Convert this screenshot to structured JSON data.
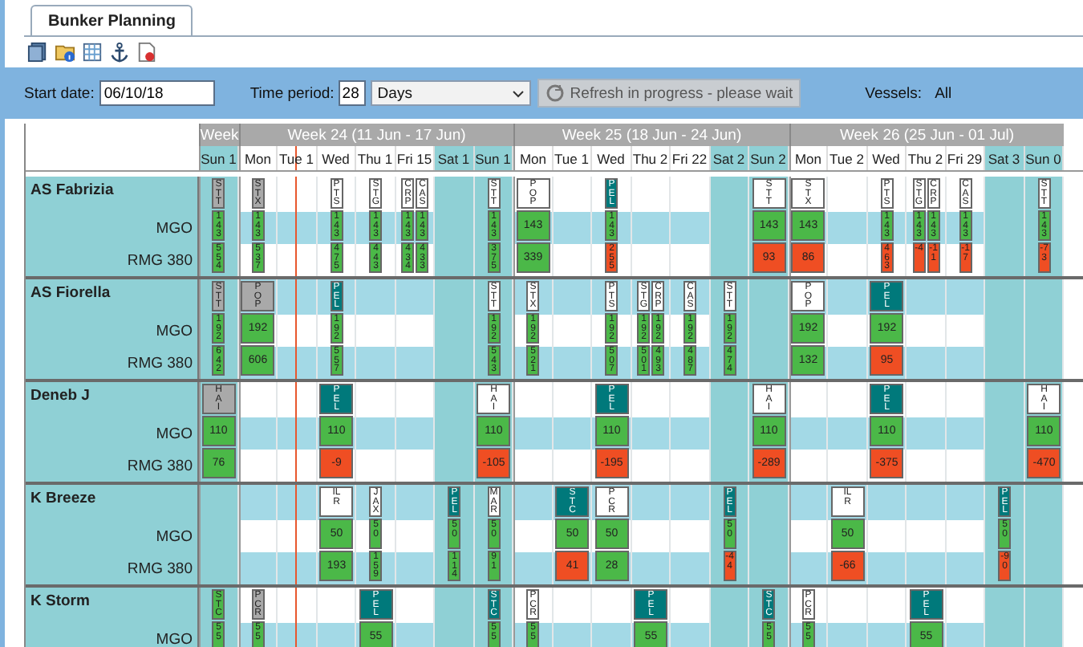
{
  "tab": {
    "label": "Bunker Planning",
    "selected": true
  },
  "filters": {
    "start_date_label": "Start date:",
    "start_date": "06/10/18",
    "period_label": "Time period:",
    "period": "28",
    "unit": "Days",
    "refresh_button": {
      "label": "Refresh in progress - please wait",
      "disabled": true
    },
    "vessels_label": "Vessels:",
    "vessels_value": "All"
  },
  "schedule": {
    "weeks": [
      {
        "label": "Week",
        "days": [
          {
            "label": "Sun 1",
            "weekend": true,
            "current": false
          }
        ]
      },
      {
        "label": "Week 24 (11 Jun - 17 Jun)",
        "days": [
          {
            "label": "Mon",
            "weekend": false,
            "current": false
          },
          {
            "label": "Tue 1",
            "weekend": false,
            "current": true
          },
          {
            "label": "Wed",
            "weekend": false,
            "current": false
          },
          {
            "label": "Thu 1",
            "weekend": false,
            "current": false
          },
          {
            "label": "Fri 15",
            "weekend": false,
            "current": false
          },
          {
            "label": "Sat 1",
            "weekend": true,
            "current": false
          },
          {
            "label": "Sun 1",
            "weekend": true,
            "current": false
          }
        ]
      },
      {
        "label": "Week 25 (18 Jun - 24 Jun)",
        "days": [
          {
            "label": "Mon",
            "weekend": false,
            "current": false
          },
          {
            "label": "Tue 1",
            "weekend": false,
            "current": false
          },
          {
            "label": "Wed",
            "weekend": false,
            "current": false
          },
          {
            "label": "Thu 2",
            "weekend": false,
            "current": false
          },
          {
            "label": "Fri 22",
            "weekend": false,
            "current": false
          },
          {
            "label": "Sat 2",
            "weekend": true,
            "current": false
          },
          {
            "label": "Sun 2",
            "weekend": true,
            "current": false
          }
        ]
      },
      {
        "label": "Week 26 (25 Jun - 01 Jul)",
        "days": [
          {
            "label": "Mon",
            "weekend": false,
            "current": false
          },
          {
            "label": "Tue 2",
            "weekend": false,
            "current": false
          },
          {
            "label": "Wed",
            "weekend": false,
            "current": false
          },
          {
            "label": "Thu 2",
            "weekend": false,
            "current": false
          },
          {
            "label": "Fri 29",
            "weekend": false,
            "current": false
          },
          {
            "label": "Sat 3",
            "weekend": true,
            "current": false
          },
          {
            "label": "Sun 0",
            "weekend": true,
            "current": false
          }
        ]
      }
    ],
    "vessels": [
      {
        "name": "AS Fabrizia",
        "fuels": [
          "MGO",
          "RMG 380"
        ],
        "calls": [
          {
            "port": "STT",
            "kind": "grey",
            "wide": false,
            "amounts": [
              {
                "value": "143",
                "short": false
              },
              {
                "value": "554",
                "short": false
              }
            ]
          },
          {
            "port": "STX",
            "kind": "grey",
            "wide": false,
            "amounts": [
              {
                "value": "143",
                "short": false
              },
              {
                "value": "537",
                "short": false
              }
            ]
          },
          {
            "port": "PTS",
            "kind": "white",
            "wide": false,
            "amounts": [
              {
                "value": "143",
                "short": false
              },
              {
                "value": "475",
                "short": false
              }
            ]
          },
          {
            "port": "STG",
            "kind": "white",
            "wide": false,
            "amounts": [
              {
                "value": "143",
                "short": false
              },
              {
                "value": "443",
                "short": false
              }
            ]
          },
          {
            "port": "CRP",
            "kind": "white",
            "wide": false,
            "amounts": [
              {
                "value": "143",
                "short": false
              },
              {
                "value": "434",
                "short": false
              }
            ]
          },
          {
            "port": "CAS",
            "kind": "white",
            "wide": false,
            "amounts": [
              {
                "value": "143",
                "short": false
              },
              {
                "value": "433",
                "short": false
              }
            ]
          },
          {
            "port": "STT",
            "kind": "white",
            "wide": false,
            "amounts": [
              {
                "value": "143",
                "short": false
              },
              {
                "value": "375",
                "short": false
              }
            ]
          },
          {
            "port": "POP",
            "kind": "white",
            "wide": true,
            "amounts": [
              {
                "value": "143",
                "short": false
              },
              {
                "value": "339",
                "short": false
              }
            ]
          },
          {
            "port": "PEL",
            "kind": "teal",
            "wide": false,
            "amounts": [
              {
                "value": "143",
                "short": false
              },
              {
                "value": "255",
                "short": true
              }
            ]
          },
          {
            "port": "STT",
            "kind": "white",
            "wide": true,
            "amounts": [
              {
                "value": "143",
                "short": false
              },
              {
                "value": "93",
                "short": true
              }
            ]
          },
          {
            "port": "STX",
            "kind": "white",
            "wide": true,
            "amounts": [
              {
                "value": "143",
                "short": false
              },
              {
                "value": "86",
                "short": true
              }
            ]
          },
          {
            "port": "PTS",
            "kind": "white",
            "wide": false,
            "amounts": [
              {
                "value": "143",
                "short": false
              },
              {
                "value": "463",
                "short": true
              }
            ]
          },
          {
            "port": "STG",
            "kind": "white",
            "wide": false,
            "amounts": [
              {
                "value": "143",
                "short": false
              },
              {
                "value": "-4",
                "short": true
              }
            ]
          },
          {
            "port": "CRP",
            "kind": "white",
            "wide": false,
            "amounts": [
              {
                "value": "143",
                "short": false
              },
              {
                "value": "-11",
                "short": true
              }
            ]
          },
          {
            "port": "CAS",
            "kind": "white",
            "wide": false,
            "amounts": [
              {
                "value": "143",
                "short": false
              },
              {
                "value": "-17",
                "short": true
              }
            ]
          },
          {
            "port": "STT",
            "kind": "white",
            "wide": false,
            "amounts": [
              {
                "value": "143",
                "short": false
              },
              {
                "value": "-73",
                "short": true
              }
            ]
          }
        ]
      },
      {
        "name": "AS Fiorella",
        "fuels": [
          "MGO",
          "RMG 380"
        ],
        "calls": [
          {
            "port": "STT",
            "kind": "grey",
            "wide": false,
            "amounts": [
              {
                "value": "192",
                "short": false
              },
              {
                "value": "642",
                "short": false
              }
            ]
          },
          {
            "port": "POP",
            "kind": "grey",
            "wide": true,
            "amounts": [
              {
                "value": "192",
                "short": false
              },
              {
                "value": "606",
                "short": false
              }
            ]
          },
          {
            "port": "PEL",
            "kind": "teal",
            "wide": false,
            "amounts": [
              {
                "value": "192",
                "short": false
              },
              {
                "value": "557",
                "short": false
              }
            ]
          },
          {
            "port": "STT",
            "kind": "white",
            "wide": false,
            "amounts": [
              {
                "value": "192",
                "short": false
              },
              {
                "value": "543",
                "short": false
              }
            ]
          },
          {
            "port": "STX",
            "kind": "white",
            "wide": false,
            "amounts": [
              {
                "value": "192",
                "short": false
              },
              {
                "value": "521",
                "short": false
              }
            ]
          },
          {
            "port": "PTS",
            "kind": "white",
            "wide": false,
            "amounts": [
              {
                "value": "192",
                "short": false
              },
              {
                "value": "507",
                "short": false
              }
            ]
          },
          {
            "port": "STG",
            "kind": "white",
            "wide": false,
            "amounts": [
              {
                "value": "192",
                "short": false
              },
              {
                "value": "501",
                "short": false
              }
            ]
          },
          {
            "port": "CRP",
            "kind": "white",
            "wide": false,
            "amounts": [
              {
                "value": "192",
                "short": false
              },
              {
                "value": "493",
                "short": false
              }
            ]
          },
          {
            "port": "CAS",
            "kind": "white",
            "wide": false,
            "amounts": [
              {
                "value": "192",
                "short": false
              },
              {
                "value": "487",
                "short": false
              }
            ]
          },
          {
            "port": "STT",
            "kind": "white",
            "wide": false,
            "amounts": [
              {
                "value": "192",
                "short": false
              },
              {
                "value": "474",
                "short": false
              }
            ]
          },
          {
            "port": "POP",
            "kind": "white",
            "wide": true,
            "amounts": [
              {
                "value": "192",
                "short": false
              },
              {
                "value": "132",
                "short": false
              }
            ]
          },
          {
            "port": "PEL",
            "kind": "teal",
            "wide": true,
            "amounts": [
              {
                "value": "192",
                "short": false
              },
              {
                "value": "95",
                "short": true
              }
            ]
          }
        ]
      },
      {
        "name": "Deneb J",
        "fuels": [
          "MGO",
          "RMG 380"
        ],
        "calls": [
          {
            "port": "HAI",
            "kind": "grey",
            "wide": true,
            "amounts": [
              {
                "value": "110",
                "short": false
              },
              {
                "value": "76",
                "short": false
              }
            ]
          },
          {
            "port": "PEL",
            "kind": "teal",
            "wide": true,
            "amounts": [
              {
                "value": "110",
                "short": false
              },
              {
                "value": "-9",
                "short": true
              }
            ]
          },
          {
            "port": "HAI",
            "kind": "white",
            "wide": true,
            "amounts": [
              {
                "value": "110",
                "short": false
              },
              {
                "value": "-105",
                "short": true
              }
            ]
          },
          {
            "port": "PEL",
            "kind": "teal",
            "wide": true,
            "amounts": [
              {
                "value": "110",
                "short": false
              },
              {
                "value": "-195",
                "short": true
              }
            ]
          },
          {
            "port": "HAI",
            "kind": "white",
            "wide": true,
            "amounts": [
              {
                "value": "110",
                "short": false
              },
              {
                "value": "-289",
                "short": true
              }
            ]
          },
          {
            "port": "PEL",
            "kind": "teal",
            "wide": true,
            "amounts": [
              {
                "value": "110",
                "short": false
              },
              {
                "value": "-375",
                "short": true
              }
            ]
          },
          {
            "port": "HAI",
            "kind": "white",
            "wide": true,
            "amounts": [
              {
                "value": "110",
                "short": false
              },
              {
                "value": "-470",
                "short": true
              }
            ]
          }
        ]
      },
      {
        "name": "K Breeze",
        "fuels": [
          "MGO",
          "RMG 380"
        ],
        "calls": [
          {
            "port": "ILR",
            "kind": "white",
            "wide": true,
            "amounts": [
              {
                "value": "50",
                "short": false
              },
              {
                "value": "193",
                "short": false
              }
            ]
          },
          {
            "port": "JAX",
            "kind": "white",
            "wide": false,
            "amounts": [
              {
                "value": "50",
                "short": false
              },
              {
                "value": "159",
                "short": false
              }
            ]
          },
          {
            "port": "PEL",
            "kind": "teal",
            "wide": false,
            "amounts": [
              {
                "value": "50",
                "short": false
              },
              {
                "value": "114",
                "short": false
              }
            ]
          },
          {
            "port": "MAR",
            "kind": "white",
            "wide": false,
            "amounts": [
              {
                "value": "50",
                "short": false
              },
              {
                "value": "91",
                "short": false
              }
            ]
          },
          {
            "port": "STC",
            "kind": "teal",
            "wide": true,
            "amounts": [
              {
                "value": "50",
                "short": false
              },
              {
                "value": "41",
                "short": true
              }
            ]
          },
          {
            "port": "PCR",
            "kind": "white",
            "wide": true,
            "amounts": [
              {
                "value": "50",
                "short": false
              },
              {
                "value": "28",
                "short": false
              }
            ]
          },
          {
            "port": "PEL",
            "kind": "teal",
            "wide": false,
            "amounts": [
              {
                "value": "50",
                "short": false
              },
              {
                "value": "-44",
                "short": true
              }
            ]
          },
          {
            "port": "ILR",
            "kind": "white",
            "wide": true,
            "amounts": [
              {
                "value": "50",
                "short": false
              },
              {
                "value": "-66",
                "short": true
              }
            ]
          },
          {
            "port": "PEL",
            "kind": "teal",
            "wide": false,
            "amounts": [
              {
                "value": "50",
                "short": false
              },
              {
                "value": "-90",
                "short": true
              }
            ]
          }
        ]
      },
      {
        "name": "K Storm",
        "fuels": [
          "MGO"
        ],
        "calls": [
          {
            "port": "STC",
            "kind": "green",
            "wide": false,
            "amounts": [
              {
                "value": "55",
                "short": false
              }
            ]
          },
          {
            "port": "PCR",
            "kind": "grey",
            "wide": false,
            "amounts": [
              {
                "value": "55",
                "short": false
              }
            ]
          },
          {
            "port": "PEL",
            "kind": "teal",
            "wide": true,
            "amounts": [
              {
                "value": "55",
                "short": false
              }
            ]
          },
          {
            "port": "STC",
            "kind": "teal",
            "wide": false,
            "amounts": [
              {
                "value": "55",
                "short": false
              }
            ]
          },
          {
            "port": "PCR",
            "kind": "white",
            "wide": false,
            "amounts": [
              {
                "value": "55",
                "short": false
              }
            ]
          },
          {
            "port": "PEL",
            "kind": "teal",
            "wide": true,
            "amounts": [
              {
                "value": "55",
                "short": false
              }
            ]
          },
          {
            "port": "STC",
            "kind": "teal",
            "wide": false,
            "amounts": [
              {
                "value": "55",
                "short": false
              }
            ]
          },
          {
            "port": "PCR",
            "kind": "white",
            "wide": false,
            "amounts": [
              {
                "value": "55",
                "short": false
              }
            ]
          },
          {
            "port": "PEL",
            "kind": "teal",
            "wide": true,
            "amounts": [
              {
                "value": "55",
                "short": false
              }
            ]
          }
        ]
      }
    ]
  }
}
